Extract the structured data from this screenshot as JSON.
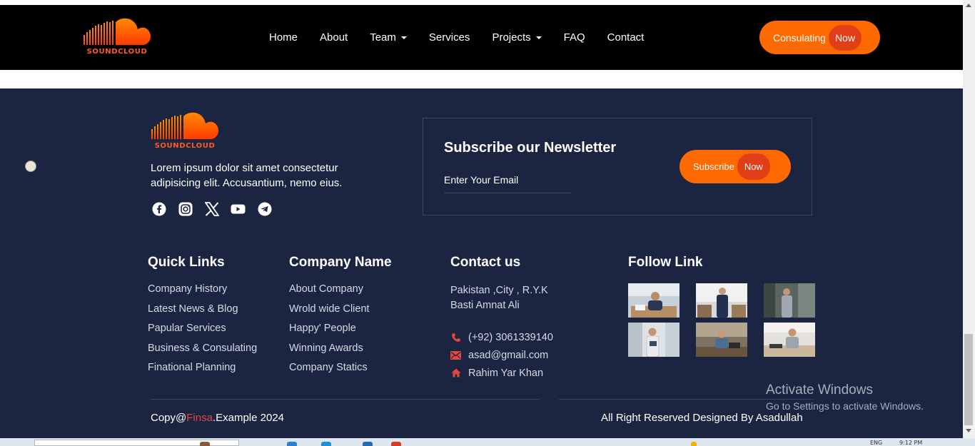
{
  "brand": {
    "name": "SOUNDCLOUD",
    "accent_color": "#ff5a1f",
    "button_color": "#ff6a00",
    "now_color": "#e23e17"
  },
  "nav": {
    "items": [
      {
        "label": "Home",
        "dropdown": false
      },
      {
        "label": "About",
        "dropdown": false
      },
      {
        "label": "Team",
        "dropdown": true
      },
      {
        "label": "Services",
        "dropdown": false
      },
      {
        "label": "Projects",
        "dropdown": true
      },
      {
        "label": "FAQ",
        "dropdown": false
      },
      {
        "label": "Contact",
        "dropdown": false
      }
    ],
    "cta": {
      "label": "Consulating",
      "emphasis": "Now"
    }
  },
  "footer": {
    "background": "#1b2542",
    "about_text": "Lorem ipsum dolor sit amet consectetur adipisicing elit. Accusantium, nemo eius.",
    "socials": [
      "facebook-icon",
      "instagram-icon",
      "x-icon",
      "youtube-icon",
      "telegram-icon"
    ],
    "newsletter": {
      "title": "Subscribe our Newsletter",
      "placeholder": "Enter Your Email",
      "button": {
        "label": "Subscribe",
        "emphasis": "Now"
      }
    },
    "quick_links": {
      "title": "Quick Links",
      "items": [
        "Company History",
        "Latest News & Blog",
        "Papular Services",
        "Business & Consulating",
        "Finational Planning"
      ]
    },
    "company": {
      "title": "Company Name",
      "items": [
        "About Company",
        "Wrold wide Client",
        "Happy' People",
        "Winning Awards",
        "Company Statics"
      ]
    },
    "contact": {
      "title": "Contact us",
      "address_line1": "Pakistan ,City , R.Y.K",
      "address_line2": "Basti Amnat Ali",
      "phone": "(+92) 3061339140",
      "email": "asad@gmail.com",
      "location": "Rahim Yar Khan"
    },
    "follow": {
      "title": "Follow Link",
      "images": [
        "office-photo-1",
        "office-photo-2",
        "office-photo-3",
        "office-photo-4",
        "office-photo-5",
        "office-photo-6"
      ]
    },
    "copyright": {
      "prefix": "Copy@",
      "brand": "Finsa",
      "suffix": ".Example 2024"
    },
    "rights": "All Right Reserved Designed By Asadullah"
  },
  "watermark": {
    "title": "Activate Windows",
    "subtitle": "Go to Settings to activate Windows."
  },
  "taskbar": {
    "lang": "ENG",
    "time": "9:12 PM"
  }
}
